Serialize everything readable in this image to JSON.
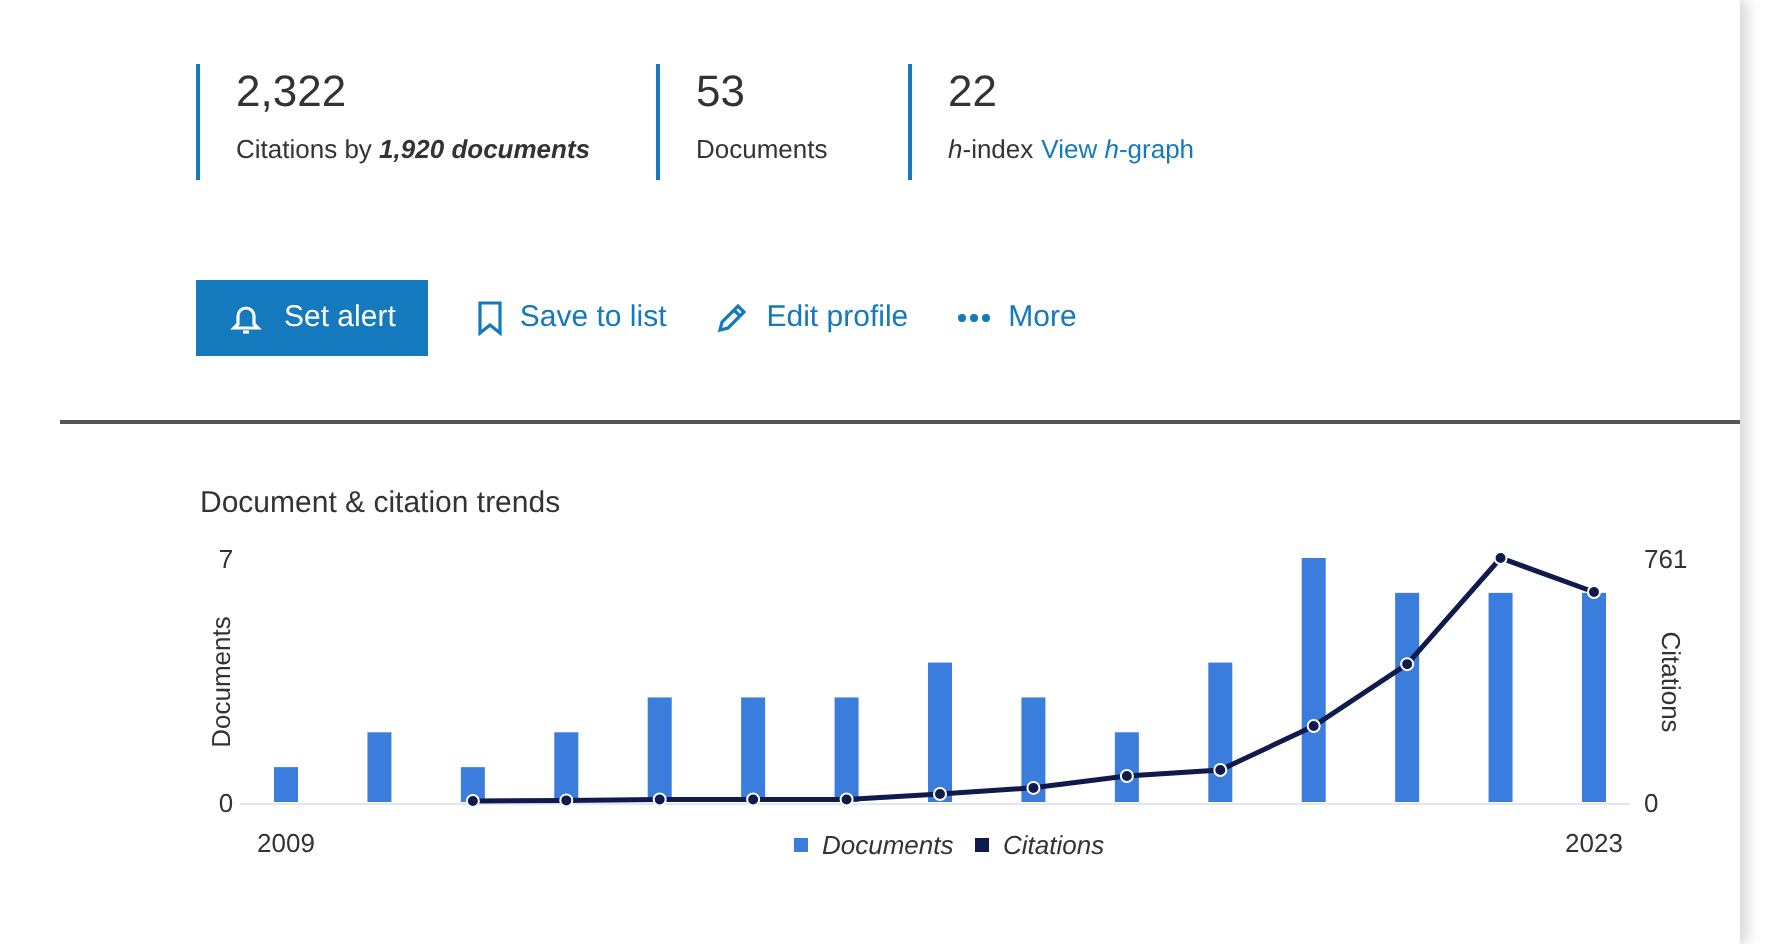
{
  "metrics": [
    {
      "value": "2,322",
      "label": "Citations by **1,920 documents**"
    },
    {
      "value": "53",
      "label": "Documents"
    },
    {
      "value": "22",
      "label": "*h*-index",
      "link": "View *h*-graph"
    }
  ],
  "actions": [
    {
      "kind": "primary",
      "label": "Set alert"
    },
    {
      "kind": "link",
      "label": "Save to list"
    },
    {
      "kind": "link",
      "label": "Edit profile"
    },
    {
      "kind": "link",
      "label": "More"
    }
  ],
  "trends": {
    "title": "Document & citation trends",
    "chart_data": {
      "type": "bar",
      "ylabel": "Documents",
      "y2label": "Citations",
      "x": [
        2009,
        2010,
        2011,
        2012,
        2013,
        2014,
        2015,
        2016,
        2017,
        2018,
        2019,
        2020,
        2021,
        2022,
        2023
      ],
      "legend": "bottom",
      "xlim": [
        2009,
        2023
      ],
      "ylim": [
        0,
        7
      ],
      "y2lim": [
        0,
        761
      ],
      "xticks": [
        2009,
        2023
      ],
      "yticks": [
        0,
        7
      ],
      "y2ticks": [
        0,
        761
      ],
      "series": [
        {
          "name": "Documents",
          "color": "#3b7ddd",
          "type": "bar",
          "values": [
            1,
            2,
            1,
            2,
            3,
            3,
            3,
            4,
            3,
            2,
            4,
            7,
            6,
            6,
            6
          ]
        },
        {
          "name": "Citations",
          "color": "#0f1a4d",
          "type": "line",
          "axis": "y2",
          "marker": "circle",
          "values": [
            null,
            null,
            3,
            5,
            8,
            8,
            8,
            25,
            44,
            81,
            100,
            237,
            430,
            761,
            655
          ]
        }
      ]
    }
  }
}
